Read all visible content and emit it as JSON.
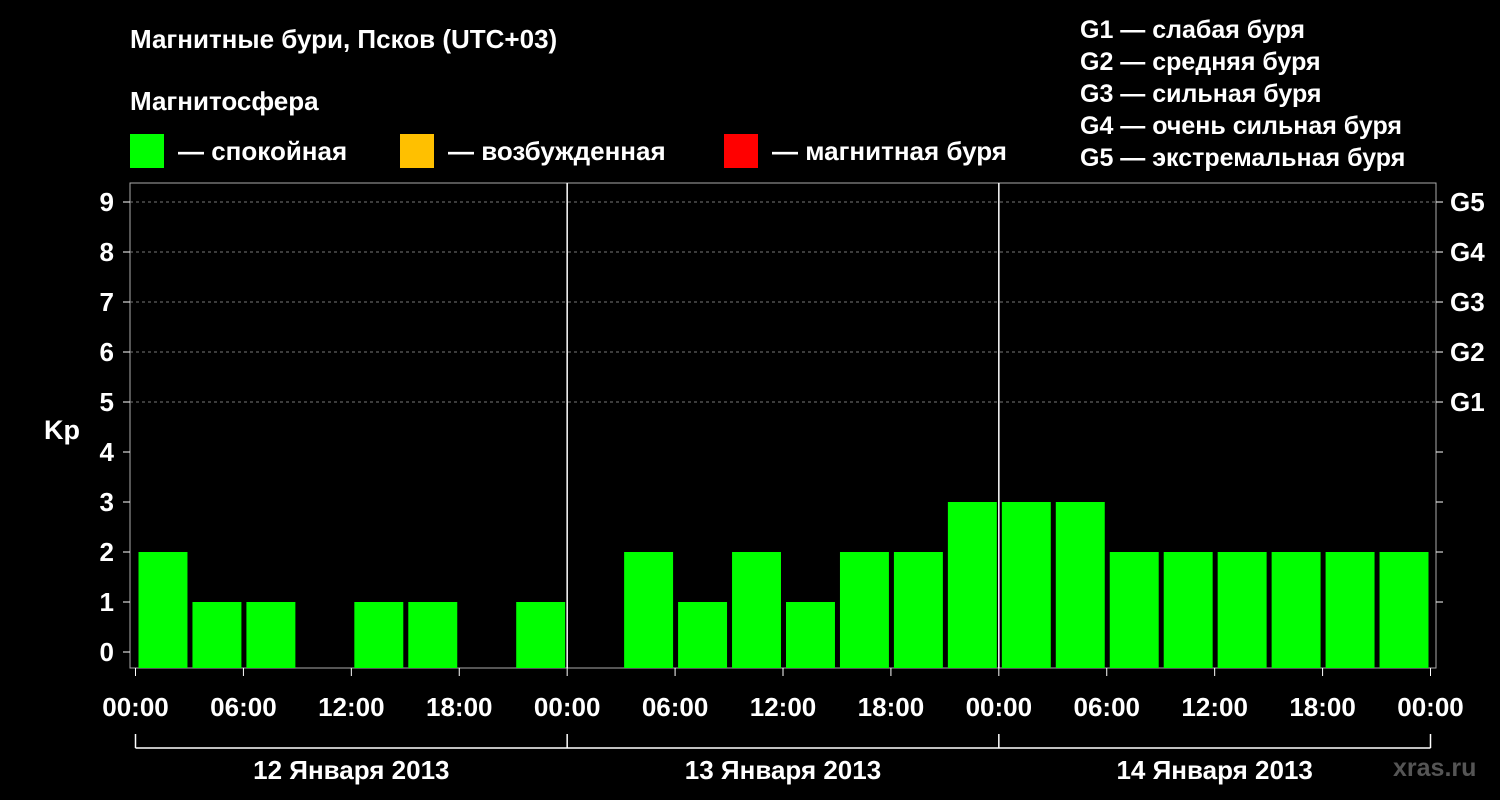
{
  "chart_data": {
    "type": "bar",
    "title": "Магнитные бури, Псков (UTC+03)",
    "subtitle": "Магнитосфера",
    "legend": [
      {
        "label": "— спокойная",
        "color": "#00ff00"
      },
      {
        "label": "— возбужденная",
        "color": "#ffc000"
      },
      {
        "label": "— магнитная буря",
        "color": "#ff0000"
      }
    ],
    "g_legend": [
      "G1 — слабая буря",
      "G2 — средняя буря",
      "G3 — сильная буря",
      "G4 — очень сильная буря",
      "G5 — экстремальная буря"
    ],
    "ylabel": "Kp",
    "ylim": [
      0,
      9
    ],
    "y_ticks": [
      "0",
      "1",
      "2",
      "3",
      "4",
      "5",
      "6",
      "7",
      "8",
      "9"
    ],
    "right_ticks": [
      {
        "value": 5,
        "label": "G1"
      },
      {
        "value": 6,
        "label": "G2"
      },
      {
        "value": 7,
        "label": "G3"
      },
      {
        "value": 8,
        "label": "G4"
      },
      {
        "value": 9,
        "label": "G5"
      }
    ],
    "x_tick_labels": [
      "00:00",
      "06:00",
      "12:00",
      "18:00",
      "00:00",
      "06:00",
      "12:00",
      "18:00",
      "00:00",
      "06:00",
      "12:00",
      "18:00",
      "00:00"
    ],
    "days": [
      "12 Января 2013",
      "13 Января 2013",
      "14 Января 2013"
    ],
    "bar_interval_hours": 3,
    "values": [
      2,
      1,
      1,
      0,
      1,
      1,
      0,
      1,
      0,
      2,
      1,
      2,
      1,
      2,
      2,
      3,
      3,
      3,
      2,
      2,
      2,
      2,
      2,
      2
    ],
    "bar_color": "#00ff00",
    "grid": true,
    "watermark": "xras.ru"
  }
}
